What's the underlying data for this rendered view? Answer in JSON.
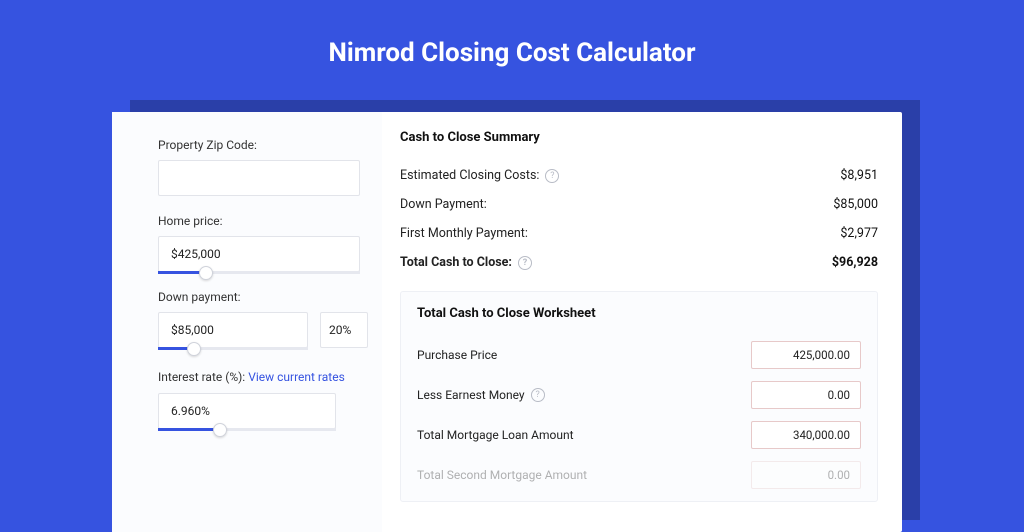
{
  "title": "Nimrod Closing Cost Calculator",
  "left": {
    "zip_label": "Property Zip Code:",
    "zip_value": "",
    "price_label": "Home price:",
    "price_value": "$425,000",
    "price_slider": {
      "pct": 24
    },
    "dp_label": "Down payment:",
    "dp_value": "$85,000",
    "dp_pct_value": "20%",
    "dp_slider": {
      "pct": 24
    },
    "ir_label_prefix": "Interest rate (%): ",
    "ir_link": "View current rates",
    "ir_value": "6.960%",
    "ir_slider": {
      "pct": 35
    }
  },
  "summary": {
    "heading": "Cash to Close Summary",
    "rows": [
      {
        "label": "Estimated Closing Costs:",
        "help": true,
        "value": "$8,951",
        "bold": false
      },
      {
        "label": "Down Payment:",
        "help": false,
        "value": "$85,000",
        "bold": false
      },
      {
        "label": "First Monthly Payment:",
        "help": false,
        "value": "$2,977",
        "bold": false
      },
      {
        "label": "Total Cash to Close:",
        "help": true,
        "value": "$96,928",
        "bold": true
      }
    ]
  },
  "worksheet": {
    "heading": "Total Cash to Close Worksheet",
    "rows": [
      {
        "label": "Purchase Price",
        "help": false,
        "value": "425,000.00"
      },
      {
        "label": "Less Earnest Money",
        "help": true,
        "value": "0.00"
      },
      {
        "label": "Total Mortgage Loan Amount",
        "help": false,
        "value": "340,000.00"
      },
      {
        "label": "Total Second Mortgage Amount",
        "help": false,
        "value": "0.00"
      }
    ]
  }
}
